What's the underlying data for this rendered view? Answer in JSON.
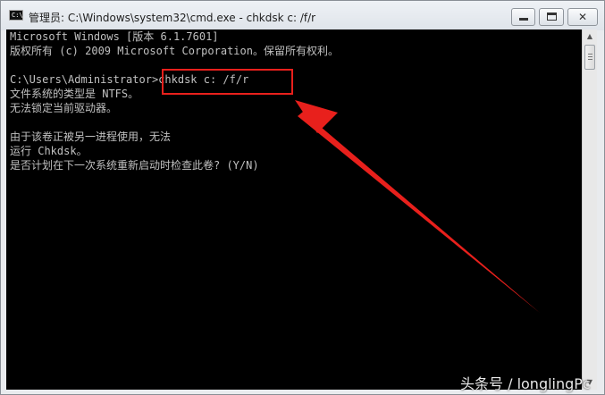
{
  "window": {
    "title": "管理员: C:\\Windows\\system32\\cmd.exe - chkdsk  c: /f/r",
    "icon": "cmd-icon",
    "icon_label": "C:\\"
  },
  "controls": {
    "minimize_icon": "minimize-icon",
    "maximize_icon": "maximize-icon",
    "close_label": "✕"
  },
  "console": {
    "lines": [
      "Microsoft Windows [版本 6.1.7601]",
      "版权所有 (c) 2009 Microsoft Corporation。保留所有权利。",
      "",
      "C:\\Users\\Administrator>chkdsk c: /f/r",
      "文件系统的类型是 NTFS。",
      "无法锁定当前驱动器。",
      "",
      "由于该卷正被另一进程使用，无法",
      "运行 Chkdsk。",
      "是否计划在下一次系统重新启动时检查此卷? (Y/N)"
    ]
  },
  "annotation": {
    "color": "#e8201c"
  },
  "watermark": "头条号 / longlingPc"
}
